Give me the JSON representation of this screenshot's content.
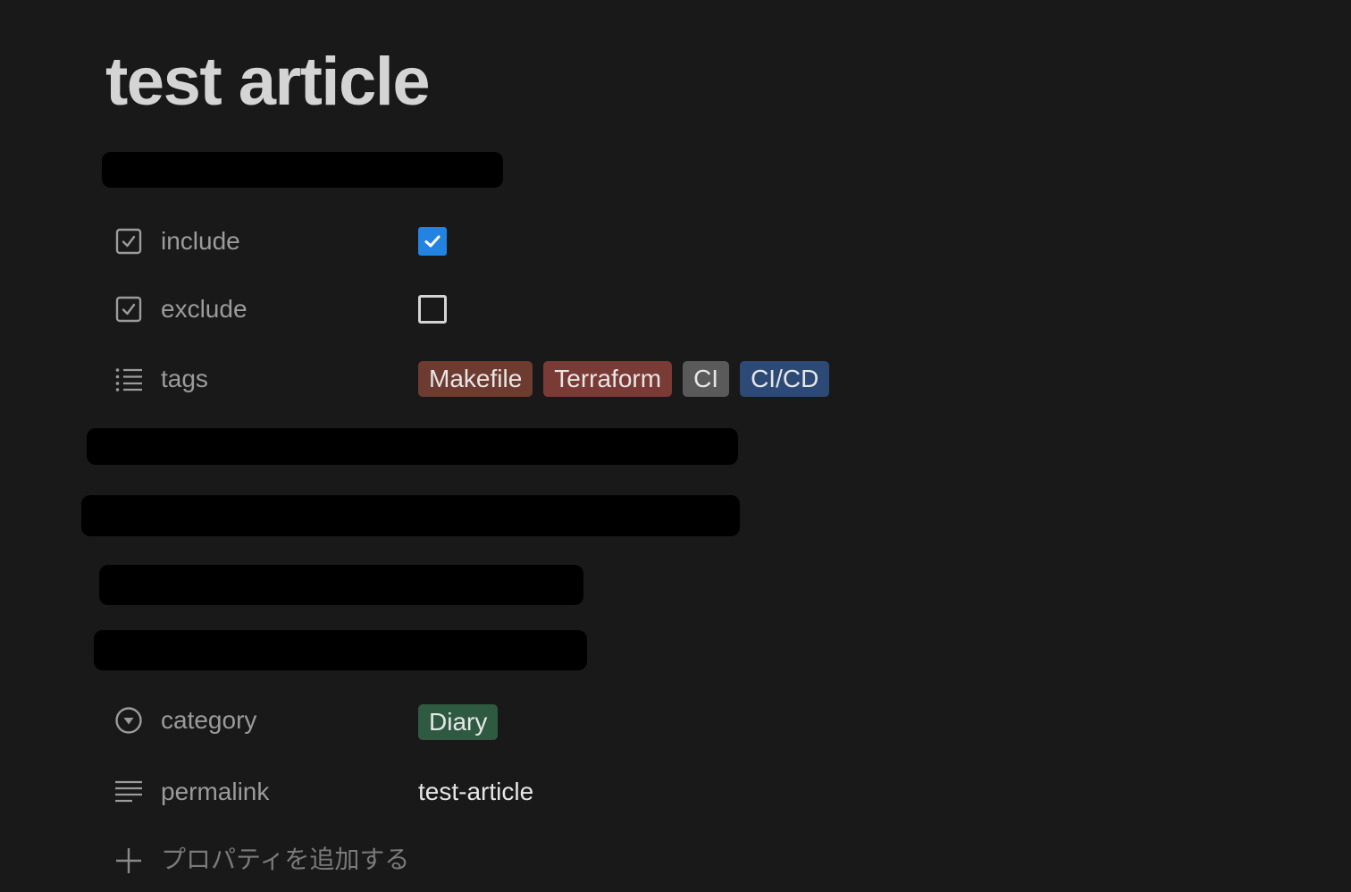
{
  "page": {
    "title": "test article"
  },
  "properties": {
    "include": {
      "label": "include",
      "icon": "checkbox-property-icon",
      "checked": true
    },
    "exclude": {
      "label": "exclude",
      "icon": "checkbox-property-icon",
      "checked": false
    },
    "tags": {
      "label": "tags",
      "icon": "list-icon",
      "items": [
        {
          "label": "Makefile",
          "color": "#6e3b30"
        },
        {
          "label": "Terraform",
          "color": "#7a3a35"
        },
        {
          "label": "CI",
          "color": "#5a5a5a"
        },
        {
          "label": "CI/CD",
          "color": "#2c4a75"
        }
      ]
    },
    "category": {
      "label": "category",
      "icon": "select-icon",
      "value": "Diary",
      "color": "#2e5a41"
    },
    "permalink": {
      "label": "permalink",
      "icon": "text-lines-icon",
      "value": "test-article"
    }
  },
  "add_property": {
    "label": "プロパティを追加する",
    "icon": "plus-icon"
  },
  "colors": {
    "background": "#191919",
    "checkbox_accent": "#2383e2",
    "label_text": "#9b9b9b"
  }
}
